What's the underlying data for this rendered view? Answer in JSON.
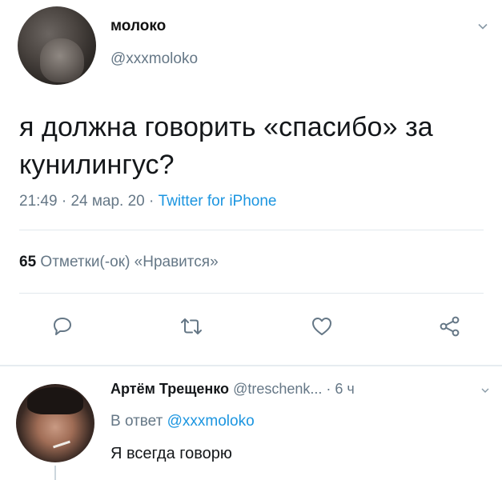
{
  "tweet": {
    "display_name": "молоко",
    "handle": "@xxxmoloko",
    "text": "я должна говорить «спасибо» за кунилингус?",
    "time": "21:49",
    "date": "24 мар. 20",
    "meta_separator": " · ",
    "source": "Twitter for iPhone",
    "likes_count": "65",
    "likes_label": "Отметки(-ок) «Нравится»"
  },
  "actions": [
    "reply-icon",
    "retweet-icon",
    "like-icon",
    "share-icon"
  ],
  "reply": {
    "display_name": "Артём Трещенко",
    "handle": "@treschenk...",
    "time": "· 6 ч",
    "in_reply_label": "В ответ",
    "in_reply_mention": "@xxxmoloko",
    "text": "Я всегда говорю"
  },
  "colors": {
    "accent": "#1b95e0",
    "secondary_text": "#657786",
    "primary_text": "#14171a",
    "divider": "#e1e8ed"
  }
}
